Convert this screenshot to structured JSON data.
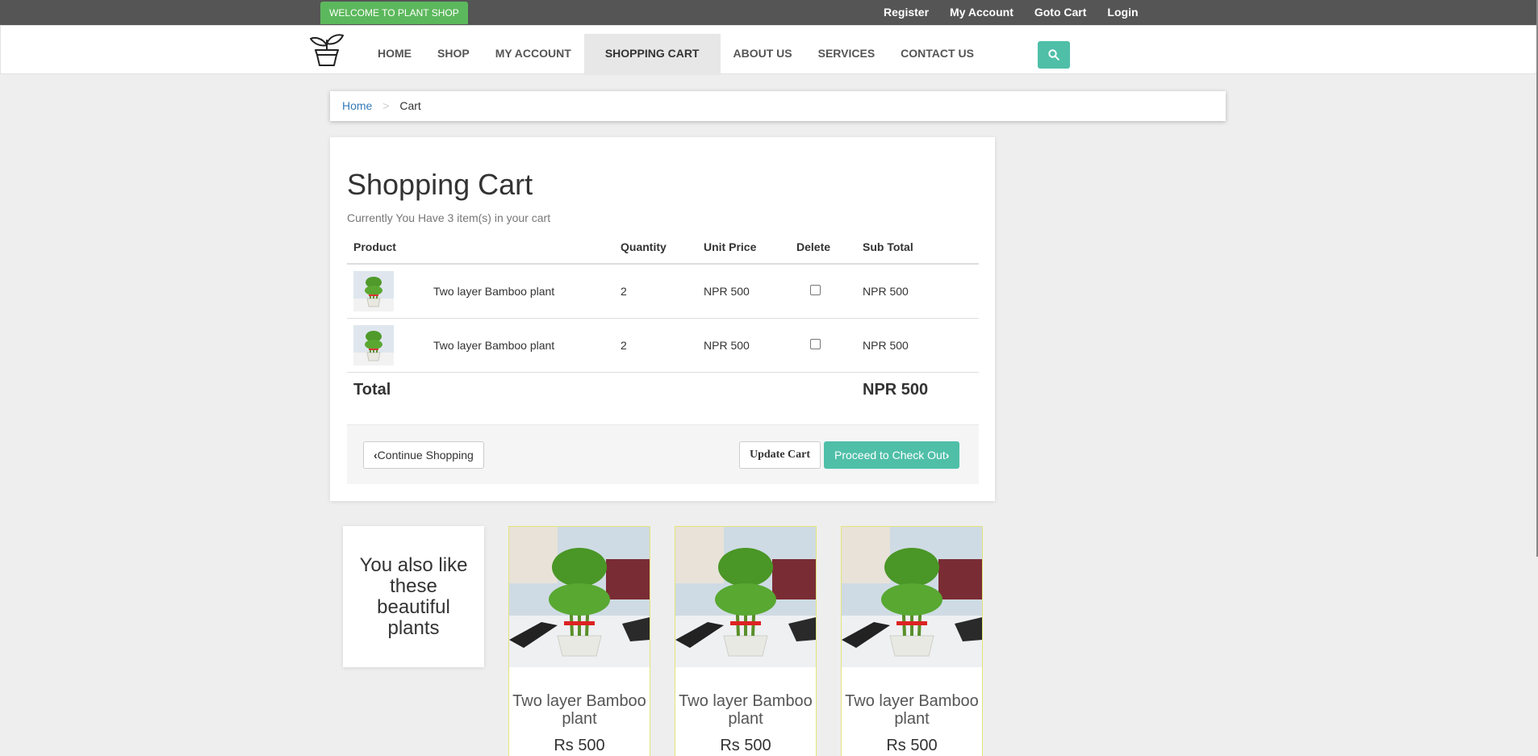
{
  "topbar": {
    "offer": "WELCOME TO PLANT SHOP",
    "links": [
      "Register",
      "My Account",
      "Goto Cart",
      "Login"
    ]
  },
  "nav": {
    "items": [
      "HOME",
      "SHOP",
      "MY ACCOUNT",
      "SHOPPING CART",
      "ABOUT US",
      "SERVICES",
      "CONTACT US"
    ],
    "active": "SHOPPING CART"
  },
  "breadcrumb": {
    "home": "Home",
    "separator": ">",
    "current": "Cart"
  },
  "cart": {
    "title": "Shopping Cart",
    "subtitle": "Currently You Have 3 item(s) in your cart",
    "columns": [
      "Product",
      "Quantity",
      "Unit Price",
      "Delete",
      "Sub Total"
    ],
    "rows": [
      {
        "name": "Two layer Bamboo plant",
        "quantity": "2",
        "unit_price": "NPR 500",
        "subtotal": "NPR 500"
      },
      {
        "name": "Two layer Bamboo plant",
        "quantity": "2",
        "unit_price": "NPR 500",
        "subtotal": "NPR 500"
      }
    ],
    "total_label": "Total",
    "total_value": "NPR 500",
    "continue_label": "Continue Shopping",
    "update_label": "Update Cart",
    "checkout_label": "Proceed to Check Out"
  },
  "recommend": {
    "heading": "You also like these beautiful plants",
    "products": [
      {
        "name": "Two layer Bamboo plant",
        "price": "Rs 500"
      },
      {
        "name": "Two layer Bamboo plant",
        "price": "Rs 500"
      },
      {
        "name": "Two layer Bamboo plant",
        "price": "Rs 500"
      }
    ]
  },
  "colors": {
    "accent": "#4fbfa8",
    "offer_green": "#5cb85c",
    "topbar": "#555555"
  }
}
